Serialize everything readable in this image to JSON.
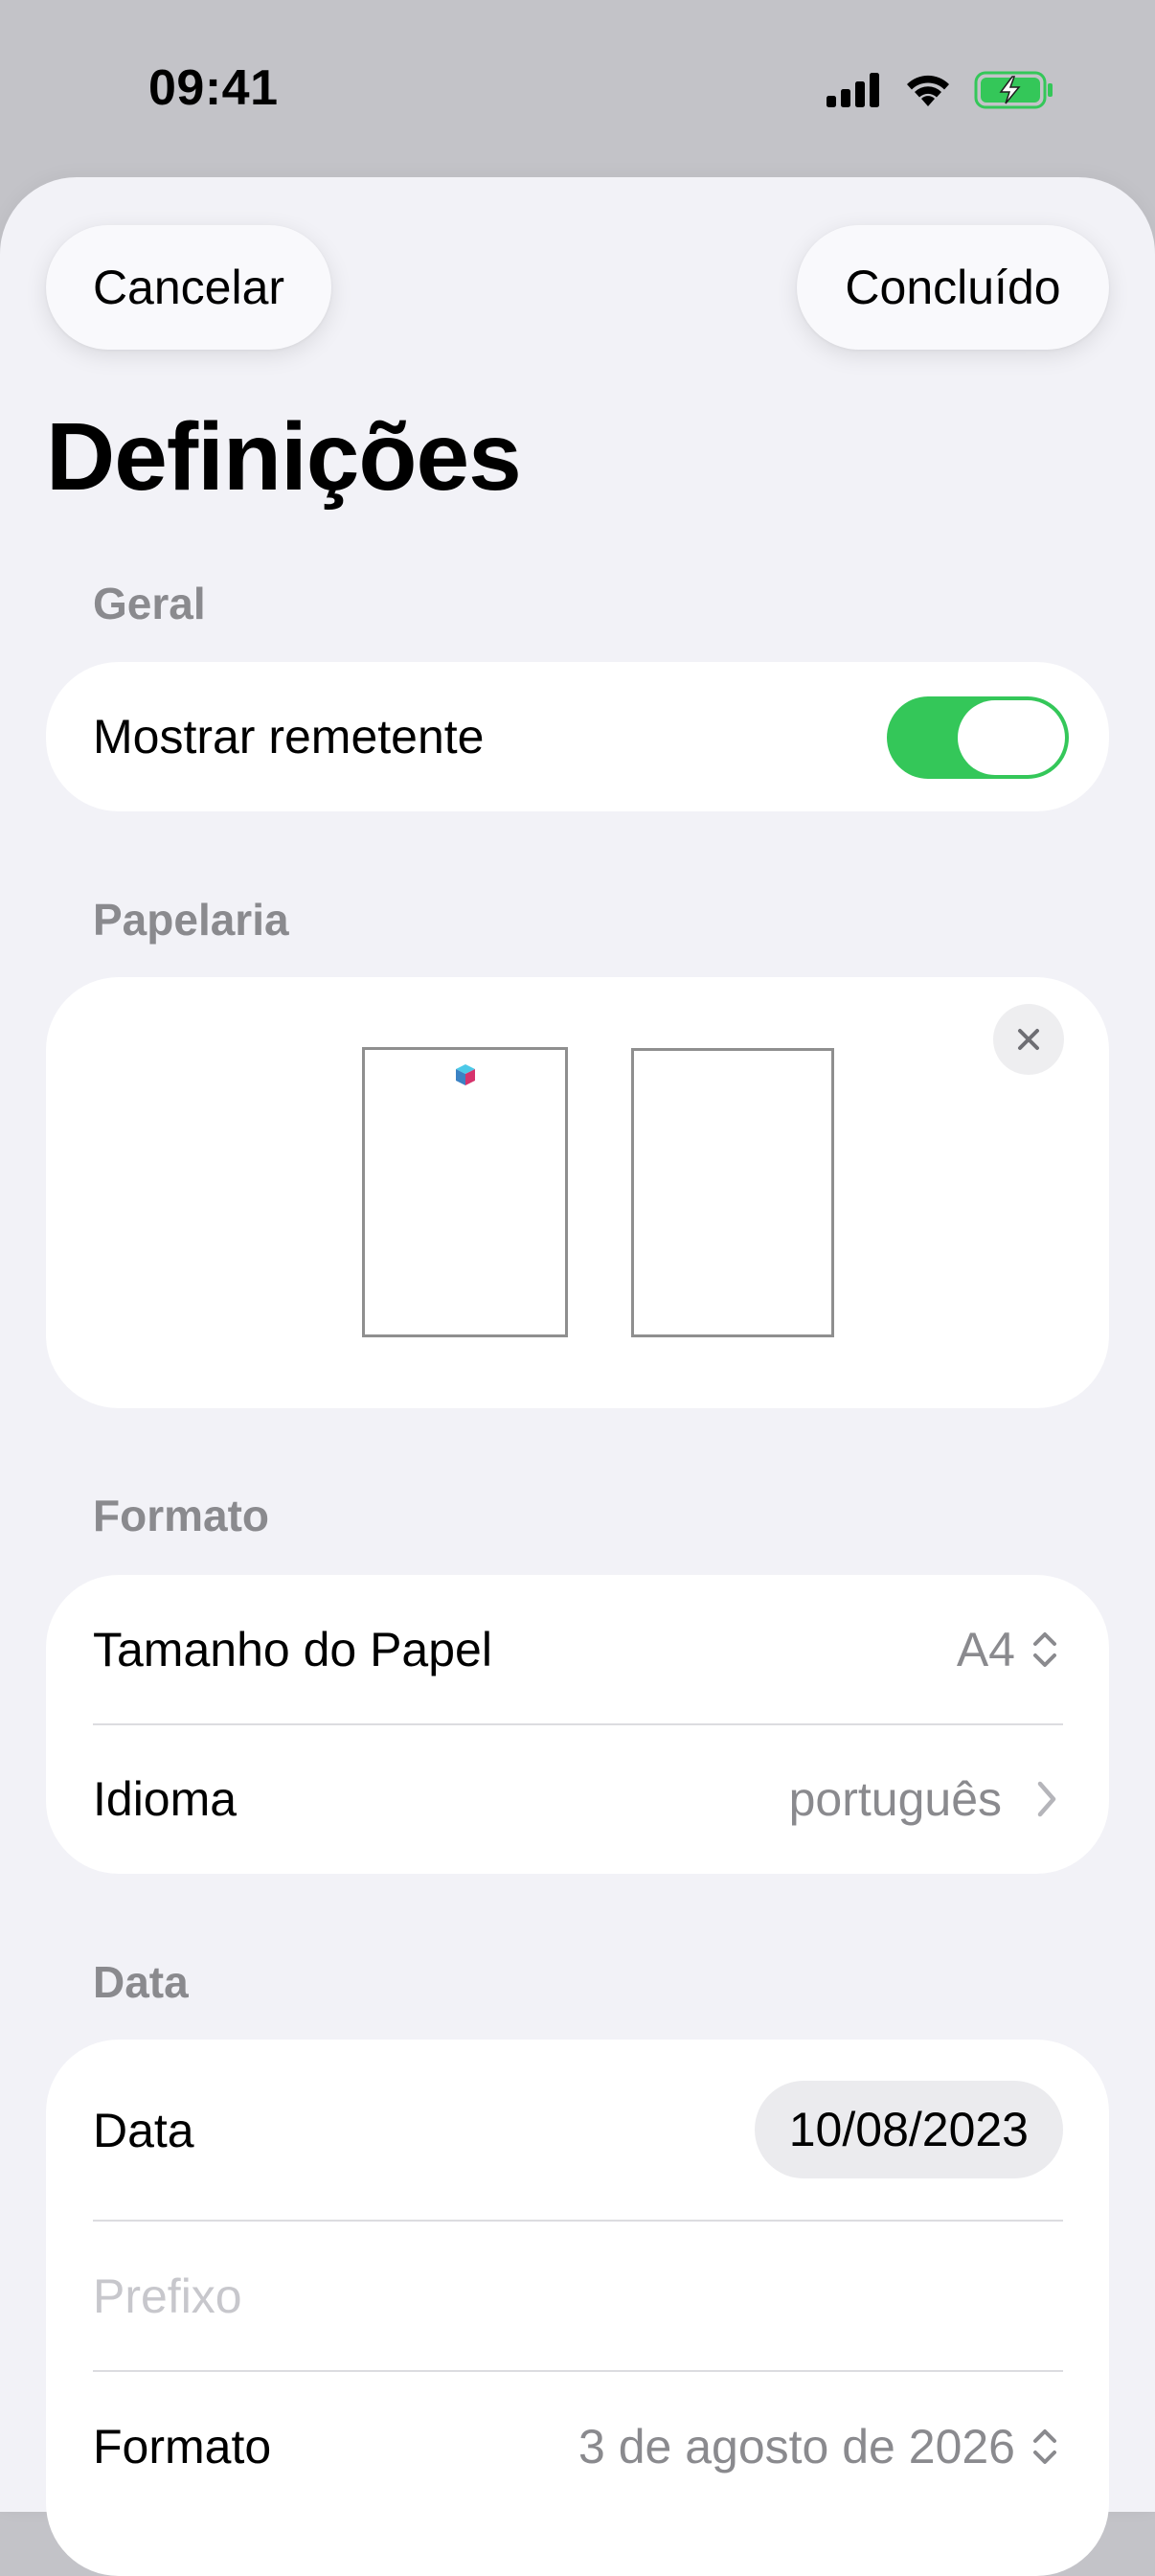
{
  "status_bar": {
    "time": "09:41",
    "icons": [
      "cellular-signal-icon",
      "wifi-icon",
      "battery-charging-icon"
    ],
    "battery_color": "#34c759"
  },
  "nav": {
    "cancel_label": "Cancelar",
    "done_label": "Concluído"
  },
  "title": "Definições",
  "sections": {
    "general": {
      "header": "Geral",
      "show_sender_label": "Mostrar remetente",
      "show_sender_on": true
    },
    "stationery": {
      "header": "Papelaria",
      "close_icon": "close-icon"
    },
    "format": {
      "header": "Formato",
      "paper_size_label": "Tamanho do Papel",
      "paper_size_value": "A4",
      "language_label": "Idioma",
      "language_value": "português"
    },
    "date": {
      "header": "Data",
      "date_label": "Data",
      "date_value": "10/08/2023",
      "prefix_placeholder": "Prefixo",
      "format_label": "Formato",
      "format_value": "3 de agosto de 2026"
    }
  },
  "colors": {
    "accent_green": "#34c759",
    "background": "#f2f2f7",
    "secondary_text": "#8a8a8e"
  }
}
